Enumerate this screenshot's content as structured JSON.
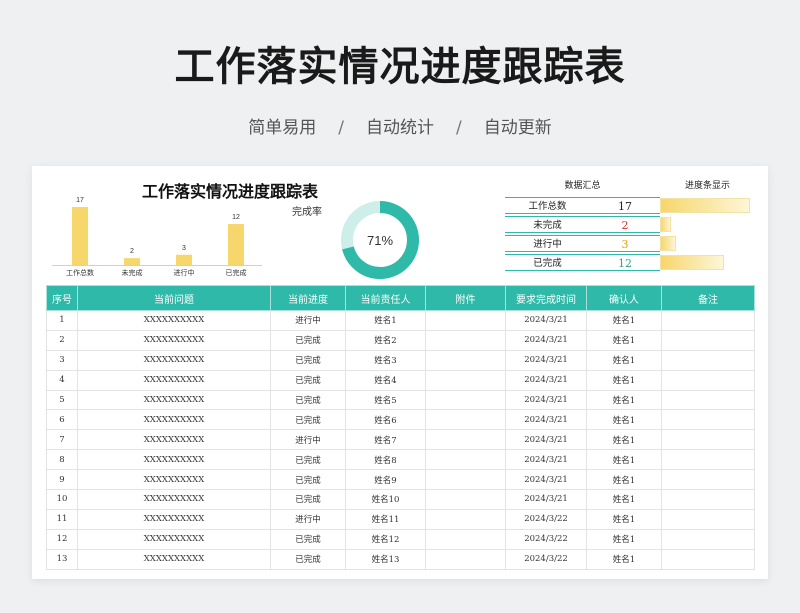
{
  "header": {
    "title": "工作落实情况进度跟踪表",
    "subtitle_items": [
      "简单易用",
      "自动统计",
      "自动更新"
    ],
    "subtitle_sep": "/"
  },
  "sheet": {
    "title": "工作落实情况进度跟踪表",
    "completion_label": "完成率",
    "completion_text": "71%"
  },
  "chart_data": {
    "type": "bar",
    "categories": [
      "工作总数",
      "未完成",
      "进行中",
      "已完成"
    ],
    "values": [
      17,
      2,
      3,
      12
    ],
    "ylim": [
      0,
      17
    ],
    "title": "",
    "xlabel": "",
    "ylabel": "",
    "bar_color": "#f7d66b"
  },
  "donut": {
    "percent": 71,
    "fg_color": "#2fb9a8",
    "bg_color": "#cdeee9"
  },
  "summary": {
    "head_left": "数据汇总",
    "head_right": "进度条显示",
    "max": 17,
    "rows": [
      {
        "label": "工作总数",
        "value": "17",
        "num": 17,
        "color": "#222222"
      },
      {
        "label": "未完成",
        "value": "2",
        "num": 2,
        "color": "#d9342b"
      },
      {
        "label": "进行中",
        "value": "3",
        "num": 3,
        "color": "#e9a300"
      },
      {
        "label": "已完成",
        "value": "12",
        "num": 12,
        "color": "#2fa38f"
      }
    ]
  },
  "table": {
    "headers": [
      "序号",
      "当前问题",
      "当前进度",
      "当前责任人",
      "附件",
      "要求完成时间",
      "确认人",
      "备注"
    ],
    "rows": [
      [
        "1",
        "XXXXXXXXXX",
        "进行中",
        "姓名1",
        "",
        "2024/3/21",
        "姓名1",
        ""
      ],
      [
        "2",
        "XXXXXXXXXX",
        "已完成",
        "姓名2",
        "",
        "2024/3/21",
        "姓名1",
        ""
      ],
      [
        "3",
        "XXXXXXXXXX",
        "已完成",
        "姓名3",
        "",
        "2024/3/21",
        "姓名1",
        ""
      ],
      [
        "4",
        "XXXXXXXXXX",
        "已完成",
        "姓名4",
        "",
        "2024/3/21",
        "姓名1",
        ""
      ],
      [
        "5",
        "XXXXXXXXXX",
        "已完成",
        "姓名5",
        "",
        "2024/3/21",
        "姓名1",
        ""
      ],
      [
        "6",
        "XXXXXXXXXX",
        "已完成",
        "姓名6",
        "",
        "2024/3/21",
        "姓名1",
        ""
      ],
      [
        "7",
        "XXXXXXXXXX",
        "进行中",
        "姓名7",
        "",
        "2024/3/21",
        "姓名1",
        ""
      ],
      [
        "8",
        "XXXXXXXXXX",
        "已完成",
        "姓名8",
        "",
        "2024/3/21",
        "姓名1",
        ""
      ],
      [
        "9",
        "XXXXXXXXXX",
        "已完成",
        "姓名9",
        "",
        "2024/3/21",
        "姓名1",
        ""
      ],
      [
        "10",
        "XXXXXXXXXX",
        "已完成",
        "姓名10",
        "",
        "2024/3/21",
        "姓名1",
        ""
      ],
      [
        "11",
        "XXXXXXXXXX",
        "进行中",
        "姓名11",
        "",
        "2024/3/22",
        "姓名1",
        ""
      ],
      [
        "12",
        "XXXXXXXXXX",
        "已完成",
        "姓名12",
        "",
        "2024/3/22",
        "姓名1",
        ""
      ],
      [
        "13",
        "XXXXXXXXXX",
        "已完成",
        "姓名13",
        "",
        "2024/3/22",
        "姓名1",
        ""
      ]
    ]
  }
}
